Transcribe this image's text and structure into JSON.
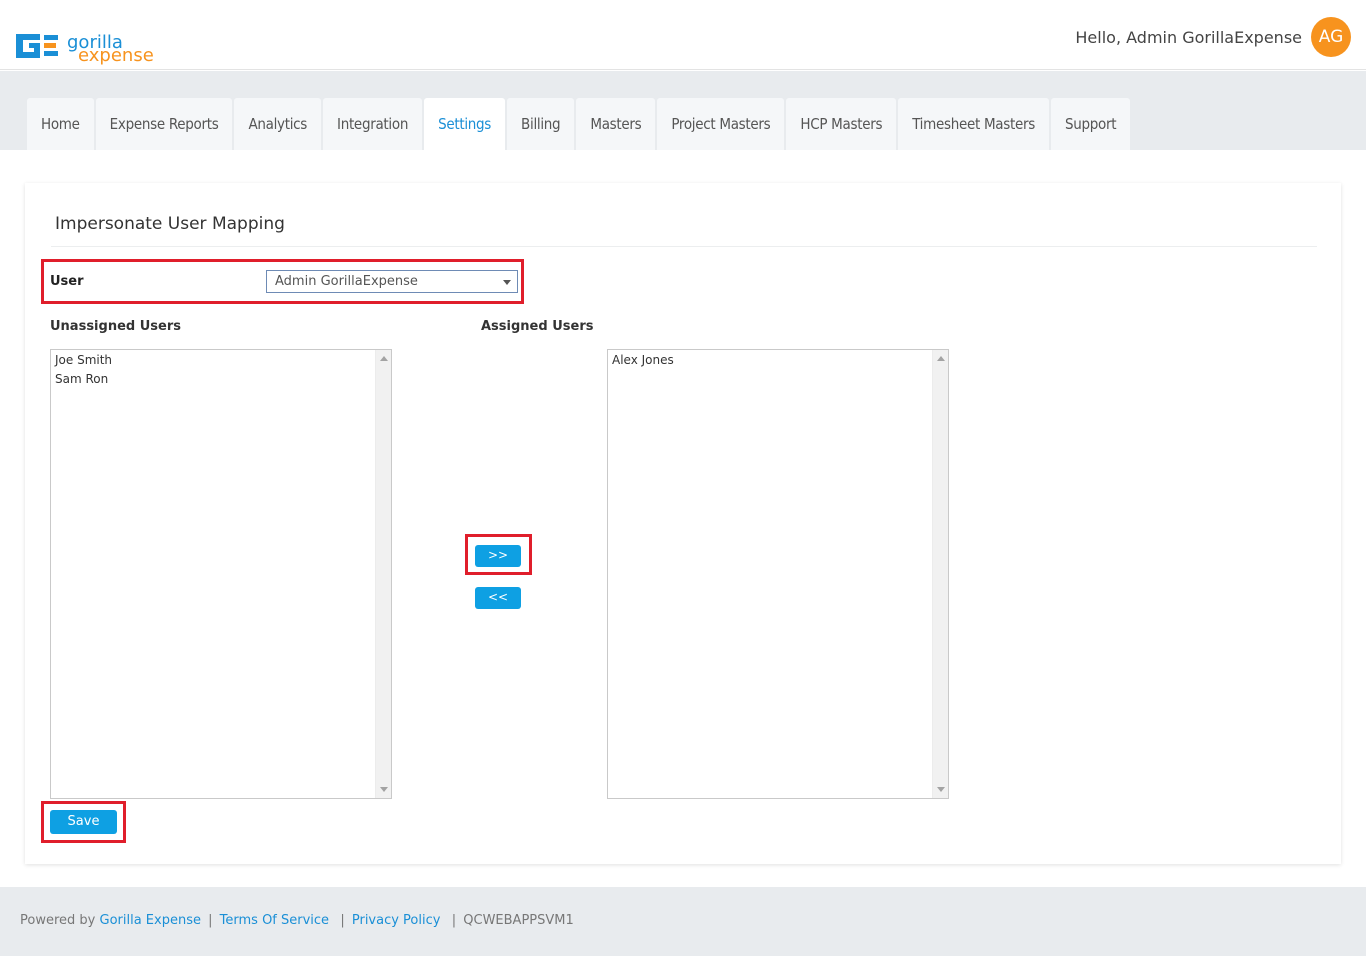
{
  "header": {
    "logo_top": "gorilla",
    "logo_bottom": "expense",
    "greeting": "Hello, Admin GorillaExpense",
    "avatar_initials": "AG"
  },
  "nav": {
    "tabs": [
      {
        "label": "Home"
      },
      {
        "label": "Expense Reports"
      },
      {
        "label": "Analytics"
      },
      {
        "label": "Integration"
      },
      {
        "label": "Settings"
      },
      {
        "label": "Billing"
      },
      {
        "label": "Masters"
      },
      {
        "label": "Project Masters"
      },
      {
        "label": "HCP Masters"
      },
      {
        "label": "Timesheet Masters"
      },
      {
        "label": "Support"
      }
    ],
    "active_tab": "Settings"
  },
  "page": {
    "title": "Impersonate User Mapping",
    "user_label": "User",
    "user_select_value": "Admin GorillaExpense",
    "unassigned_label": "Unassigned Users",
    "assigned_label": "Assigned Users",
    "unassigned_users": [
      "Joe Smith",
      "Sam Ron"
    ],
    "assigned_users": [
      "Alex Jones"
    ],
    "move_right_label": ">>",
    "move_left_label": "<<",
    "save_label": "Save"
  },
  "footer": {
    "powered_by": "Powered by",
    "brand_link": "Gorilla Expense",
    "terms_link": "Terms Of Service",
    "privacy_link": "Privacy Policy",
    "server": "QCWEBAPPSVM1"
  },
  "colors": {
    "accent": "#0ea0e3",
    "brand_blue": "#1a8fd6",
    "brand_orange": "#f7931e",
    "highlight_red": "#e01e2b"
  }
}
